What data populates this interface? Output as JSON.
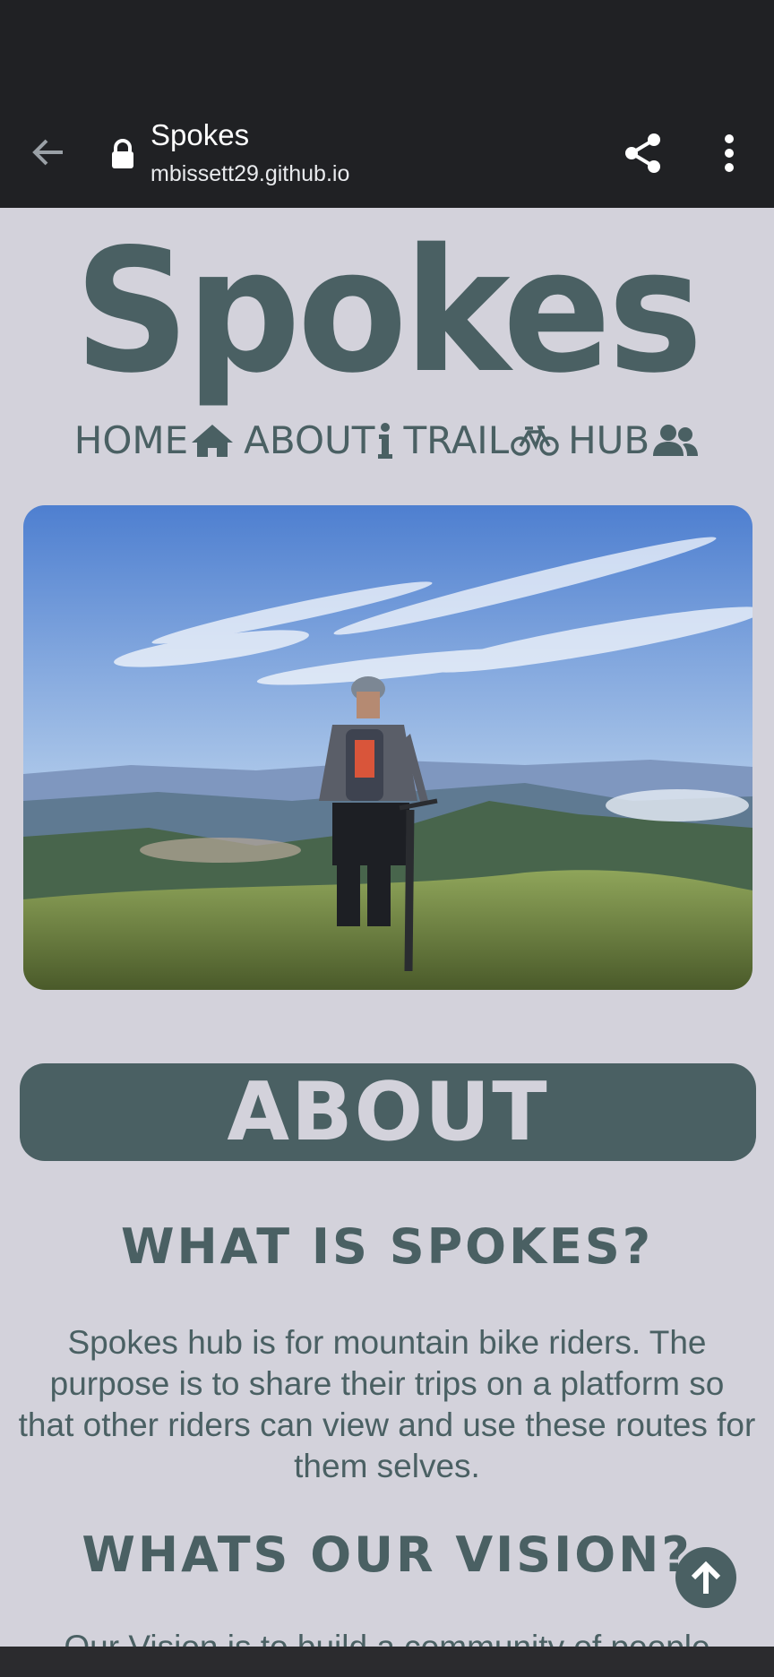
{
  "browser": {
    "tab_title": "Spokes",
    "url": "mbissett29.github.io"
  },
  "site": {
    "title": "Spokes",
    "nav": [
      {
        "label": "HOME",
        "icon": "home-icon"
      },
      {
        "label": "ABOUT",
        "icon": "info-icon"
      },
      {
        "label": "TRAIL",
        "icon": "bicycle-icon"
      },
      {
        "label": "HUB",
        "icon": "users-icon"
      }
    ]
  },
  "hero": {
    "icon": "mountain-biker-photo"
  },
  "about": {
    "banner": "ABOUT",
    "what_heading": "WHAT IS SPOKES?",
    "what_text": "Spokes hub is for mountain bike riders. The purpose is to share their trips on a platform so that other riders can view and use these routes for them selves.",
    "vision_heading": "WHATS OUR VISION?",
    "vision_text": "Our Vision is to build a community of people"
  },
  "colors": {
    "accent": "#4a6063",
    "background": "#d3d2db",
    "chrome": "#202124"
  }
}
